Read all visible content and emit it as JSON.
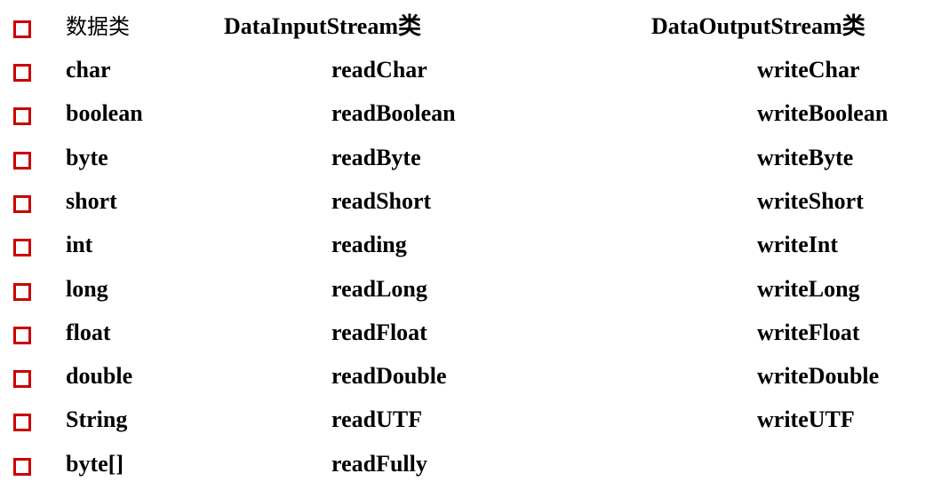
{
  "bullet_color": "#cc0000",
  "header": {
    "col1": "数据类",
    "col2": "DataInputStream类",
    "col3": "DataOutputStream类"
  },
  "rows": [
    {
      "type": "char",
      "read": "readChar",
      "write": "writeChar"
    },
    {
      "type": "boolean",
      "read": "readBoolean",
      "write": "writeBoolean"
    },
    {
      "type": "byte",
      "read": "readByte",
      "write": "writeByte"
    },
    {
      "type": "short",
      "read": "readShort",
      "write": "writeShort"
    },
    {
      "type": "int",
      "read": "reading",
      "write": "writeInt"
    },
    {
      "type": "long",
      "read": "readLong",
      "write": "writeLong"
    },
    {
      "type": "float",
      "read": "readFloat",
      "write": "writeFloat"
    },
    {
      "type": "double",
      "read": "readDouble",
      "write": "writeDouble"
    },
    {
      "type": "String",
      "read": "readUTF",
      "write": "writeUTF"
    },
    {
      "type": "byte[]",
      "read": "readFully",
      "write": ""
    }
  ]
}
